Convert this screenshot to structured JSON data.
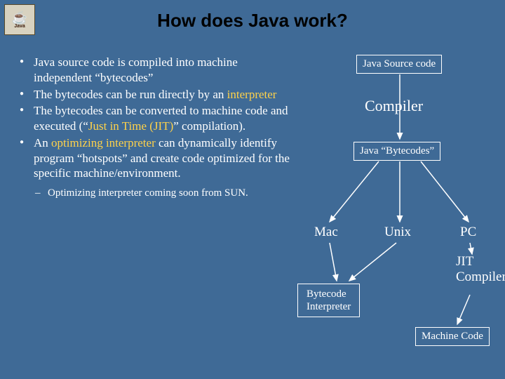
{
  "title": "How does Java work?",
  "logo": {
    "glyph": "☕",
    "text": "Java"
  },
  "bullets": [
    {
      "pre": "Java source code is compiled into machine independent “bytecodes”"
    },
    {
      "pre": "The bytecodes can be run directly by an ",
      "hl": "interpreter"
    },
    {
      "pre": "The bytecodes can be converted to machine code and executed (“",
      "hl": "Just in Time (JIT)",
      "post": "” compilation)."
    },
    {
      "pre": "An ",
      "hl": "optimizing interpreter",
      "post": " can dynamically identify program “hotspots” and create code optimized for the specific machine/environment."
    }
  ],
  "sub": [
    "Optimizing interpreter coming soon from SUN."
  ],
  "diagram": {
    "source": "Java Source code",
    "compiler": "Compiler",
    "bytecodes": "Java “Bytecodes”",
    "targets": {
      "mac": "Mac",
      "unix": "Unix",
      "pc": "PC"
    },
    "jit": "JIT Compiler",
    "interp_l1": "Bytecode",
    "interp_l2": "Interpreter",
    "machine": "Machine Code"
  }
}
